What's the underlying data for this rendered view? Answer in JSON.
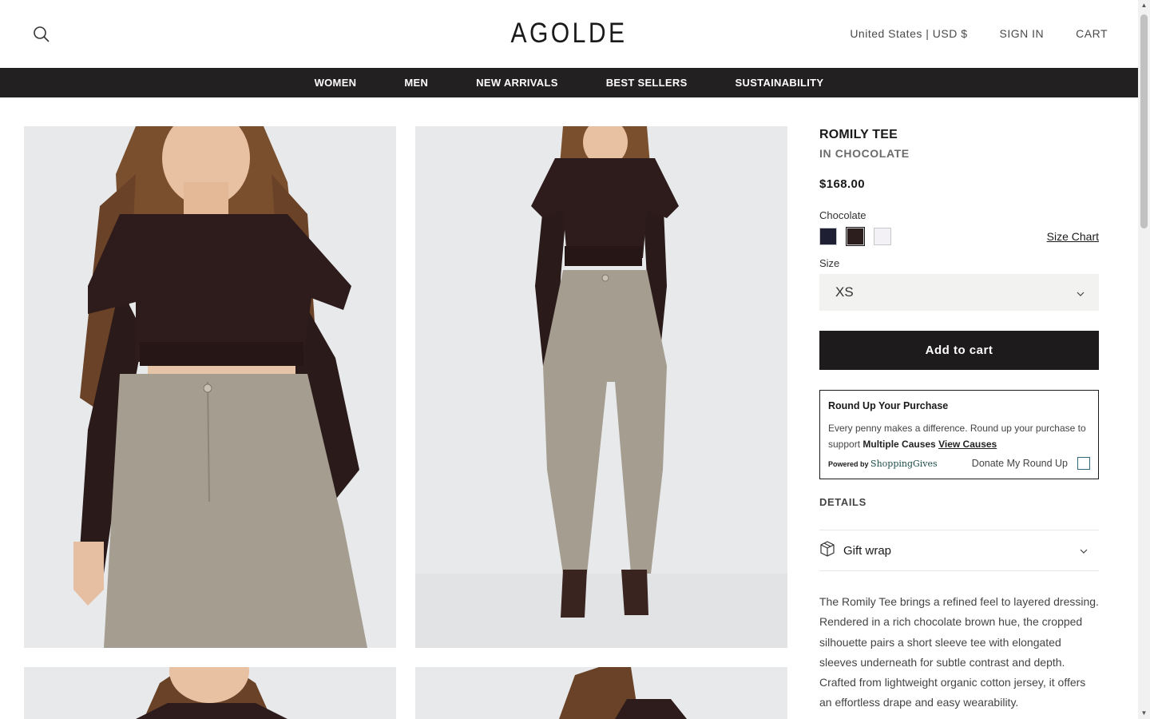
{
  "header": {
    "logo": "AGOLDE",
    "region": "United States | USD $",
    "sign_in": "SIGN IN",
    "cart": "CART"
  },
  "nav": {
    "items": [
      "WOMEN",
      "MEN",
      "NEW ARRIVALS",
      "BEST SELLERS",
      "SUSTAINABILITY"
    ]
  },
  "product": {
    "title": "ROMILY TEE",
    "subtitle": "IN CHOCOLATE",
    "price": "$168.00",
    "color_label": "Chocolate",
    "swatches": [
      {
        "name": "navy",
        "color": "#1f1f33"
      },
      {
        "name": "chocolate",
        "color": "#2d1e1e",
        "selected": true
      },
      {
        "name": "white",
        "color": "#f3f1f5"
      }
    ],
    "size_chart": "Size Chart",
    "size_label": "Size",
    "size_value": "XS",
    "add_to_cart": "Add to cart",
    "description": "The Romily Tee brings a refined feel to layered dressing. Rendered in a rich chocolate brown hue, the cropped silhouette pairs a short sleeve tee with elongated sleeves underneath for subtle contrast and depth. Crafted from lightweight organic cotton jersey, it offers an effortless drape and easy wearability."
  },
  "roundup": {
    "title": "Round Up Your Purchase",
    "text_1": "Every penny makes a difference. Round up your purchase to support",
    "bold": "Multiple Causes",
    "link": "View Causes",
    "powered_by": "Powered by",
    "brand": "ShoppingGives",
    "donate_label": "Donate My Round Up"
  },
  "details": {
    "label": "DETAILS",
    "gift_wrap": "Gift wrap"
  },
  "colors": {
    "nav_bg": "#222020",
    "button_bg": "#1d1b1b",
    "image_bg": "#e7e9eb",
    "tee": "#2e1c1c",
    "denim": "#a59d90"
  }
}
